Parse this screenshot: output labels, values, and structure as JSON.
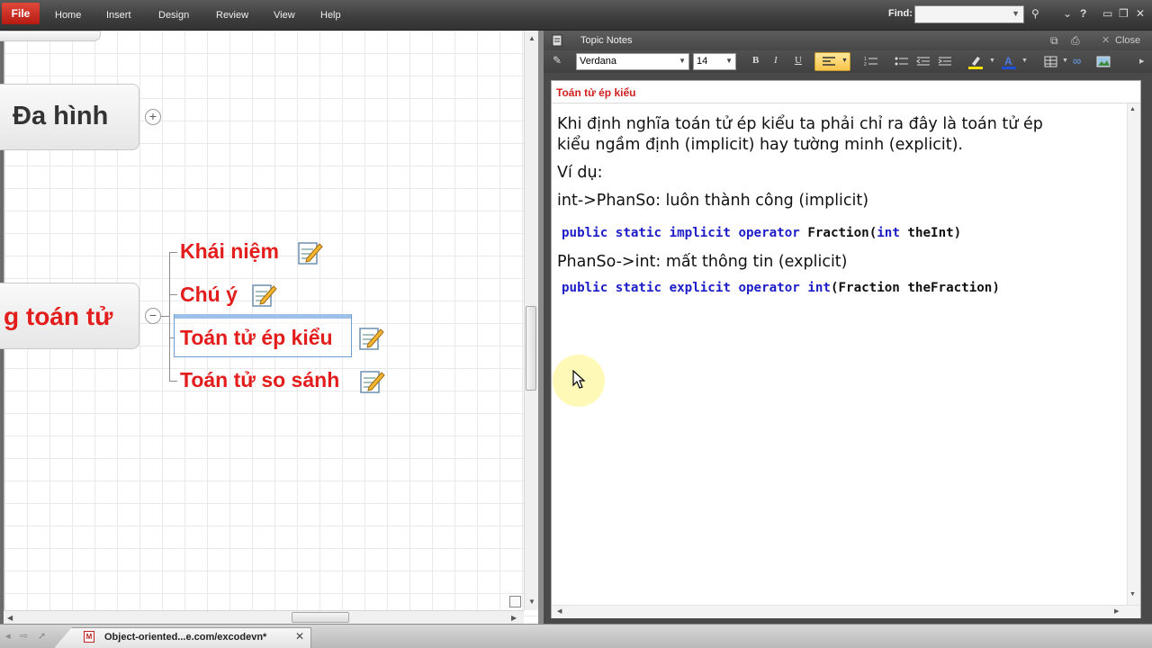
{
  "ribbon": {
    "file_label": "File",
    "tabs": [
      "Home",
      "Insert",
      "Design",
      "Review",
      "View",
      "Help"
    ],
    "find_label": "Find:",
    "find_value": ""
  },
  "map": {
    "topics": {
      "dahinh": "Đa hình",
      "toantu": "g toán tử"
    },
    "subtopics": [
      "Khái niệm",
      "Chú ý",
      "Toán tử ép kiểu",
      "Toán tử so sánh"
    ],
    "selected_subtopic": "Toán tử ép kiểu"
  },
  "notes": {
    "panel_title": "Topic Notes",
    "close_label": "Close",
    "font_name": "Verdana",
    "font_size": "14",
    "heading": "Toán tử ép kiểu",
    "paragraph1_line1": "Khi định nghĩa toán tử ép kiểu ta phải chỉ ra đây là toán tử ép",
    "paragraph1_line2": "kiểu ngầm định (implicit) hay tường minh (explicit).",
    "example_label": "Ví dụ:",
    "implicit_desc": "int->PhanSo: luôn thành công (implicit)",
    "code1": {
      "keywords": "public static implicit operator",
      "type": "Fraction",
      "paren_open": "(",
      "param_kw": "int",
      "param_rest": "theInt)"
    },
    "explicit_desc": "PhanSo->int: mất thông tin (explicit)",
    "code2": {
      "keywords": "public static explicit operator int",
      "rest": "(Fraction theFraction)"
    }
  },
  "taskbar": {
    "document_title": "Object-oriented...e.com/excodevn*"
  },
  "colors": {
    "accent_red": "#e31c1c",
    "code_keyword": "#1d1dc8",
    "file_tab": "#c8261b",
    "highlight": "#f7c44a"
  },
  "icons": [
    "note-icon",
    "plus-icon",
    "minus-icon",
    "close-icon",
    "help-icon",
    "minimize-icon",
    "maximize-icon",
    "bold-icon",
    "italic-icon",
    "underline-icon",
    "align-left-icon",
    "bullet-list-icon",
    "numbered-list-icon",
    "indent-icon",
    "outdent-icon",
    "highlight-color-icon",
    "font-color-icon",
    "table-icon",
    "link-icon",
    "image-icon",
    "mouse-cursor-icon"
  ]
}
